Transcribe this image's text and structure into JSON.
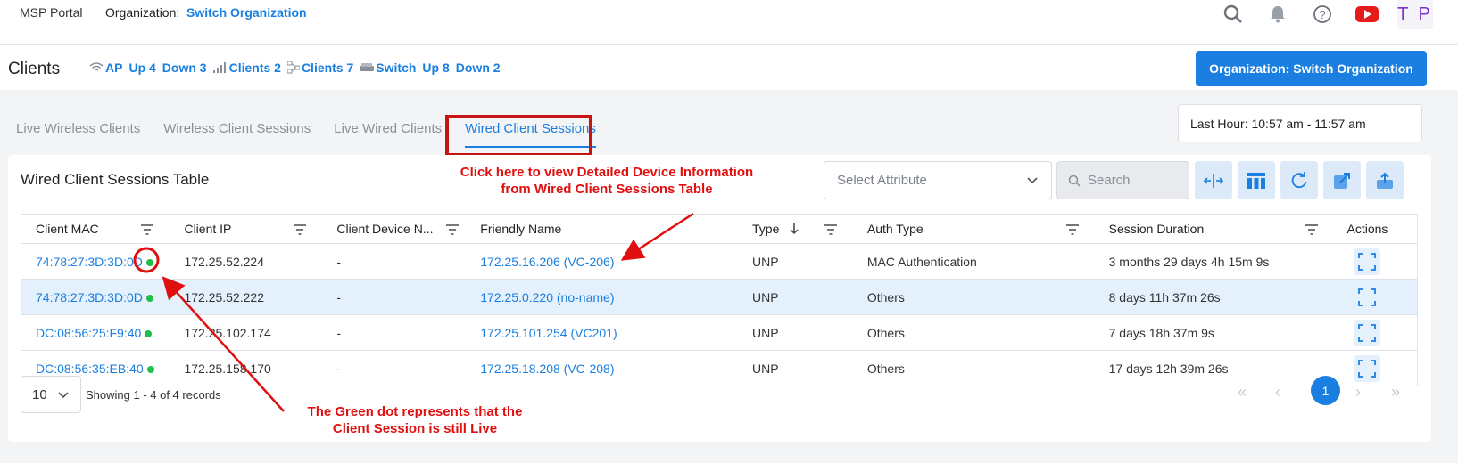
{
  "header": {
    "brand": "MSP Portal",
    "org_label": "Organization:",
    "org_link": "Switch Organization",
    "avatar": "T P",
    "icons": [
      "search-icon",
      "bell-icon",
      "help-icon",
      "youtube-icon"
    ]
  },
  "subheader": {
    "title": "Clients",
    "stats": {
      "ap_label": "AP",
      "ap_up": "Up 4",
      "ap_down": "Down 3",
      "clients_label": "Clients 2",
      "wired_clients_label": "Clients 7",
      "switch_label": "Switch",
      "switch_up": "Up 8",
      "switch_down": "Down 2"
    },
    "org_button": "Organization: Switch Organization"
  },
  "tabs": [
    {
      "label": "Live Wireless Clients",
      "active": false
    },
    {
      "label": "Wireless Client Sessions",
      "active": false
    },
    {
      "label": "Live Wired Clients",
      "active": false
    },
    {
      "label": "Wired Client Sessions",
      "active": true
    }
  ],
  "time_range": "Last Hour: 10:57 am - 11:57 am",
  "table_card": {
    "title": "Wired Client Sessions Table",
    "select_placeholder": "Select Attribute",
    "search_placeholder": "Search",
    "columns": [
      "Client MAC",
      "Client IP",
      "Client Device N...",
      "Friendly Name",
      "Type",
      "Auth Type",
      "Session Duration",
      "Actions"
    ],
    "rows": [
      {
        "mac": "74:78:27:3D:3D:0D",
        "ip": "172.25.52.224",
        "device": "-",
        "friendly": "172.25.16.206 (VC-206)",
        "type": "UNP",
        "auth": "MAC Authentication",
        "duration": "3 months 29 days 4h 15m 9s",
        "live": true
      },
      {
        "mac": "74:78:27:3D:3D:0D",
        "ip": "172.25.52.222",
        "device": "-",
        "friendly": "172.25.0.220 (no-name)",
        "type": "UNP",
        "auth": "Others",
        "duration": "8 days 11h 37m 26s",
        "live": true
      },
      {
        "mac": "DC:08:56:25:F9:40",
        "ip": "172.25.102.174",
        "device": "-",
        "friendly": "172.25.101.254 (VC201)",
        "type": "UNP",
        "auth": "Others",
        "duration": "7 days 18h 37m 9s",
        "live": true
      },
      {
        "mac": "DC:08:56:35:EB:40",
        "ip": "172.25.158.170",
        "device": "-",
        "friendly": "172.25.18.208 (VC-208)",
        "type": "UNP",
        "auth": "Others",
        "duration": "17 days 12h 39m 26s",
        "live": true
      }
    ],
    "page_size": "10",
    "records_text": "Showing 1 - 4 of 4 records",
    "current_page": "1"
  },
  "annotations": {
    "top_line1": "Click here to view Detailed Device Information",
    "top_line2": "from Wired Client Sessions Table",
    "bottom_line1": "The Green dot represents that the",
    "bottom_line2": "Client Session is still Live"
  },
  "colors": {
    "accent": "#1a7fe0",
    "annotation": "#e01010",
    "live_dot": "#1fbf4a"
  }
}
